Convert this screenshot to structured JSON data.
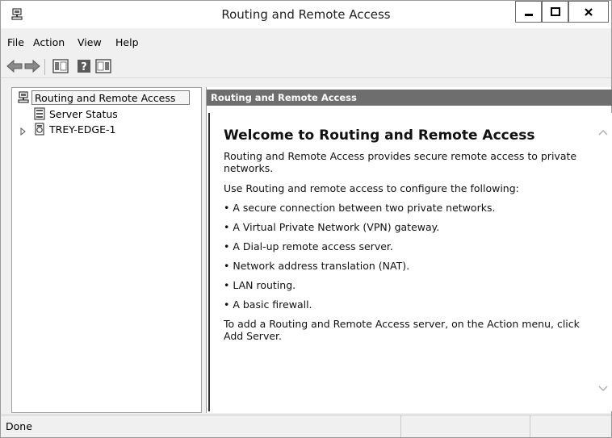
{
  "window": {
    "title": "Routing and Remote Access"
  },
  "menu": {
    "items": [
      "File",
      "Action",
      "View",
      "Help"
    ]
  },
  "toolbar": {
    "icons": [
      "back-arrow-icon",
      "forward-arrow-icon",
      "show-hide-console-tree-icon",
      "help-icon",
      "show-hide-action-pane-icon"
    ]
  },
  "tree": {
    "root": "Routing and Remote Access",
    "items": [
      "Server Status",
      "TREY-EDGE-1"
    ]
  },
  "content": {
    "header": "Routing and Remote Access",
    "welcome_title": "Welcome to Routing and Remote Access",
    "intro": "Routing and Remote Access provides secure remote access to private networks.",
    "use_line": "Use Routing and remote access to configure the following:",
    "bullets": [
      "• A secure connection between two private networks.",
      "• A Virtual Private Network (VPN) gateway.",
      "• A Dial-up remote access server.",
      "• Network address translation (NAT).",
      "• LAN routing.",
      "• A basic firewall."
    ],
    "footer": "To add a Routing and Remote Access server, on the Action menu, click Add Server."
  },
  "status": {
    "text": "Done"
  },
  "colors": {
    "header_bg": "#6e6e6e",
    "window_bg": "#f0f0f0"
  }
}
